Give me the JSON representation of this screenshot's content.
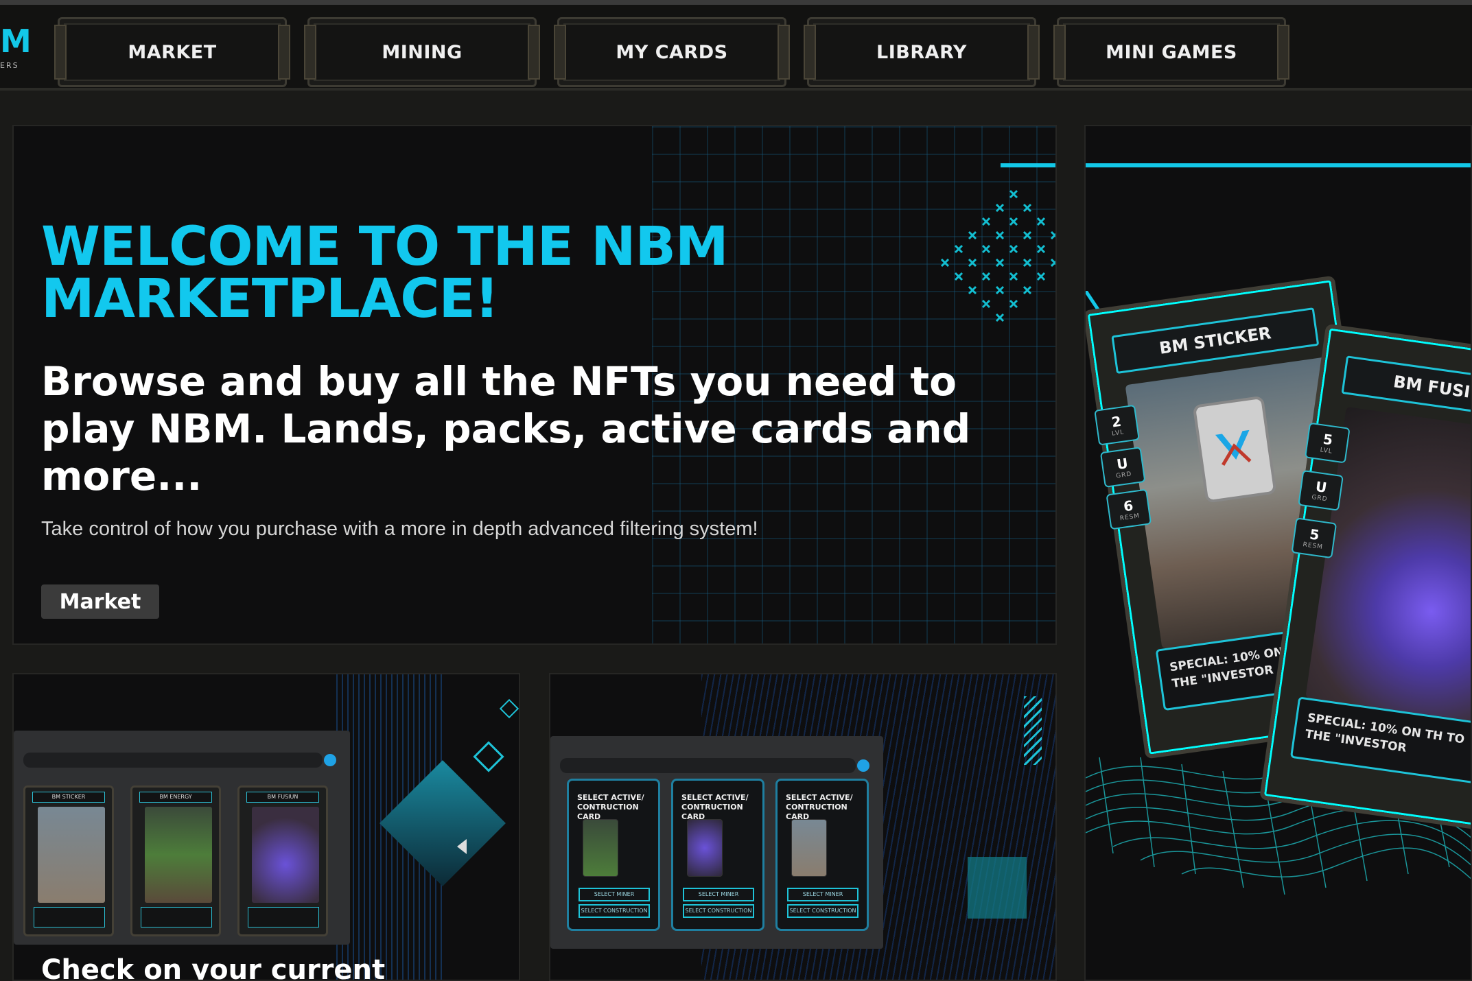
{
  "brand": {
    "logo_mark": "M",
    "logo_sub": "ERS"
  },
  "nav": {
    "items": [
      {
        "label": "MARKET"
      },
      {
        "label": "MINING"
      },
      {
        "label": "MY CARDS"
      },
      {
        "label": "LIBRARY"
      },
      {
        "label": "MINI GAMES"
      }
    ]
  },
  "hero": {
    "title": "WELCOME TO THE NBM MARKETPLACE!",
    "subtitle": "Browse and buy all the NFTs you need to play NBM. Lands, packs, active cards and more...",
    "description": "Take control of how you purchase with a more in depth advanced filtering system!",
    "button_label": "Market"
  },
  "showcase": {
    "card_left": {
      "title": "BM STICKER",
      "stats": [
        {
          "value": "2",
          "unit": "LVL"
        },
        {
          "value": "U",
          "unit": "GRD"
        },
        {
          "value": "6",
          "unit": "RESM"
        }
      ],
      "special": "SPECIAL: 10% ON TH TO THE \"INVESTOR"
    },
    "card_right": {
      "title": "BM FUSIUN",
      "stats": [
        {
          "value": "5",
          "unit": "LVL"
        },
        {
          "value": "U",
          "unit": "GRD"
        },
        {
          "value": "5",
          "unit": "RESM"
        }
      ],
      "special": "SPECIAL: 10% ON TH TO THE \"INVESTOR"
    }
  },
  "panel_a": {
    "mini_cards": [
      {
        "title": "BM STICKER"
      },
      {
        "title": "BM ENERGY"
      },
      {
        "title": "BM FUSIUN"
      }
    ],
    "heading": "Check on your current"
  },
  "panel_b": {
    "select_cards": [
      {
        "heading": "SELECT ACTIVE/ CONTRUCTION CARD",
        "btn_miner": "SELECT MINER",
        "btn_construction": "SELECT CONSTRUCTION"
      },
      {
        "heading": "SELECT ACTIVE/ CONTRUCTION CARD",
        "btn_miner": "SELECT MINER",
        "btn_construction": "SELECT CONSTRUCTION"
      },
      {
        "heading": "SELECT ACTIVE/ CONTRUCTION CARD",
        "btn_miner": "SELECT MINER",
        "btn_construction": "SELECT CONSTRUCTION"
      }
    ]
  },
  "colors": {
    "accent": "#13c8e8",
    "background": "#1a1a18",
    "panel": "#0e0e0f"
  }
}
